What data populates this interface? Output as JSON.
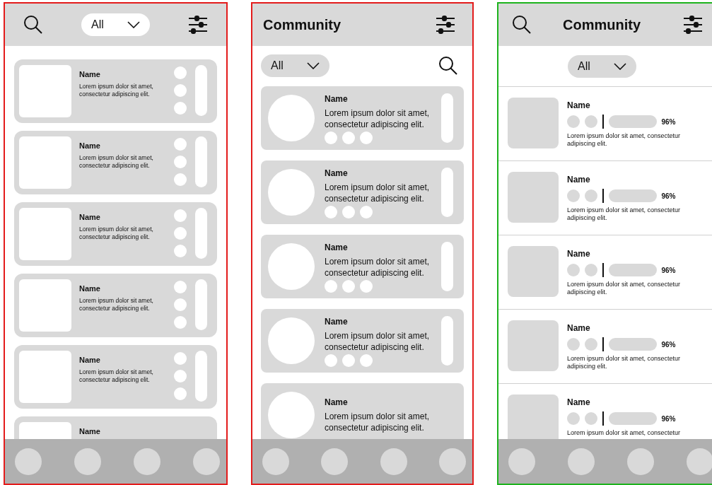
{
  "frames": [
    {
      "kind": "compact",
      "color": "#e31b1b",
      "filter": {
        "value": "All"
      },
      "cards": [
        {
          "name": "Name",
          "description": "Lorem ipsum dolor sit amet, consectetur adipiscing elit."
        },
        {
          "name": "Name",
          "description": "Lorem ipsum dolor sit amet, consectetur adipiscing elit."
        },
        {
          "name": "Name",
          "description": "Lorem ipsum dolor sit amet, consectetur adipiscing elit."
        },
        {
          "name": "Name",
          "description": "Lorem ipsum dolor sit amet, consectetur adipiscing elit."
        },
        {
          "name": "Name",
          "description": "Lorem ipsum dolor sit amet, consectetur adipiscing elit."
        },
        {
          "name": "Name"
        }
      ]
    },
    {
      "kind": "avatar",
      "color": "#e31b1b",
      "title": "Community",
      "filter": {
        "value": "All"
      },
      "cards": [
        {
          "name": "Name",
          "description": "Lorem ipsum dolor sit amet, consectetur adipiscing elit."
        },
        {
          "name": "Name",
          "description": "Lorem ipsum dolor sit amet, consectetur adipiscing elit."
        },
        {
          "name": "Name",
          "description": "Lorem ipsum dolor sit amet, consectetur adipiscing elit."
        },
        {
          "name": "Name",
          "description": "Lorem ipsum dolor sit amet, consectetur adipiscing elit."
        },
        {
          "name": "Name",
          "description": "Lorem ipsum dolor sit amet, consectetur adipiscing elit."
        }
      ]
    },
    {
      "kind": "list",
      "color": "#1db31d",
      "title": "Community",
      "filter": {
        "value": "All"
      },
      "cards": [
        {
          "name": "Name",
          "stat": "96%",
          "description": "Lorem ipsum dolor sit amet, consectetur adipiscing elit."
        },
        {
          "name": "Name",
          "stat": "96%",
          "description": "Lorem ipsum dolor sit amet, consectetur adipiscing elit."
        },
        {
          "name": "Name",
          "stat": "96%",
          "description": "Lorem ipsum dolor sit amet, consectetur adipiscing elit."
        },
        {
          "name": "Name",
          "stat": "96%",
          "description": "Lorem ipsum dolor sit amet, consectetur adipiscing elit."
        },
        {
          "name": "Name",
          "stat": "96%",
          "description": "Lorem ipsum dolor sit amet, consectetur"
        }
      ]
    }
  ]
}
